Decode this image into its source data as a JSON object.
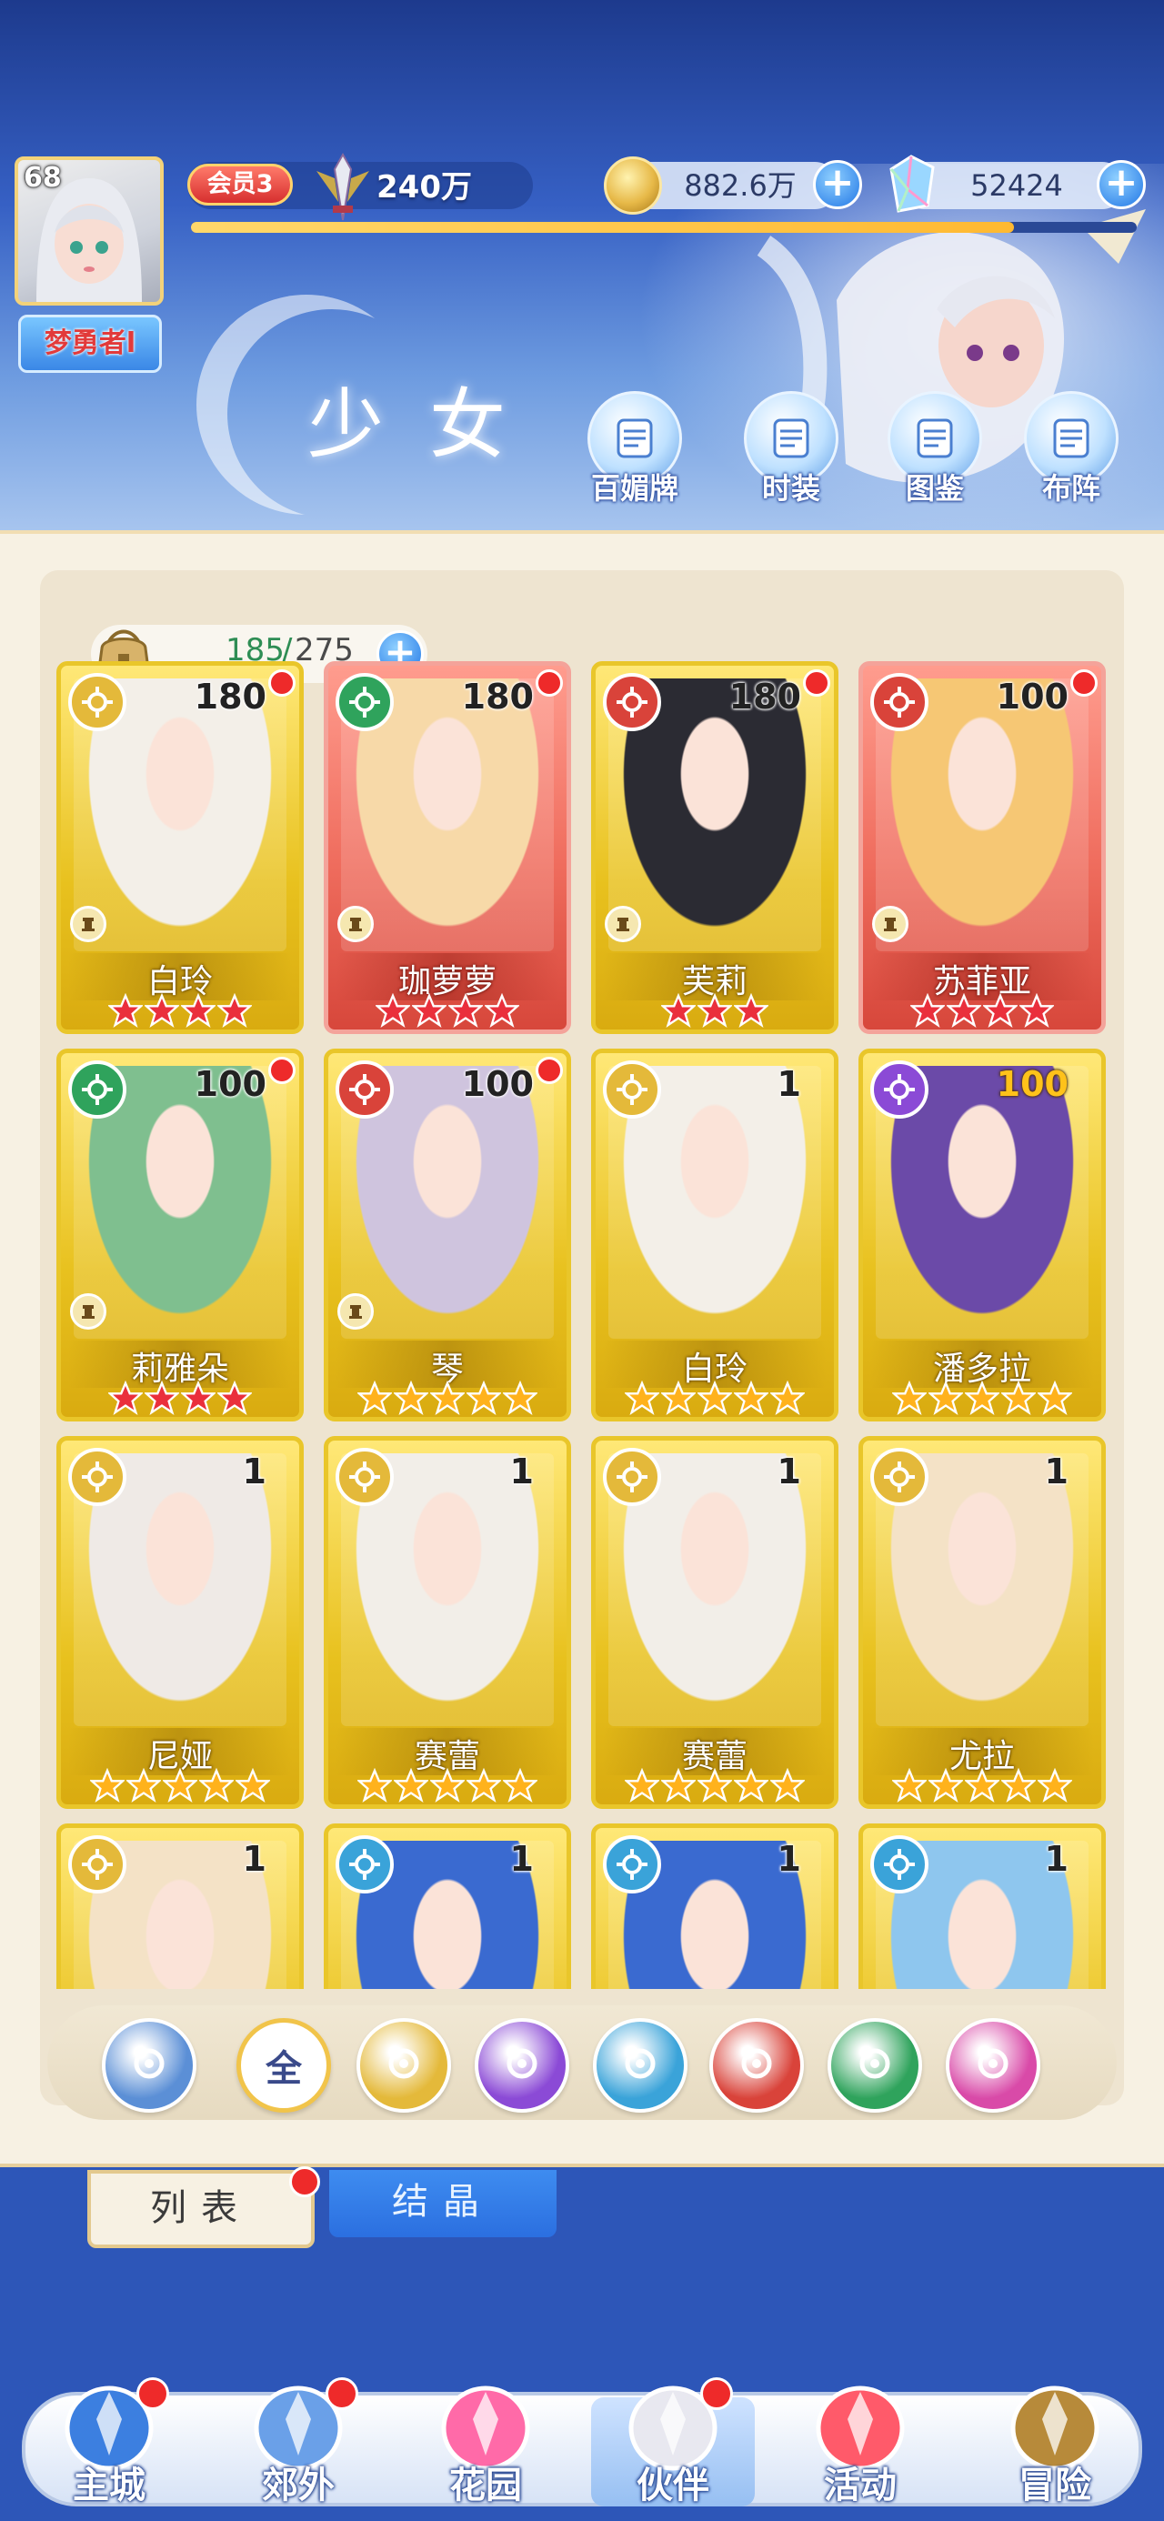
{
  "player": {
    "level": "68",
    "name": "梦勇者l",
    "vip": "会员3",
    "power": "240万",
    "exp_fraction": 0.87
  },
  "resources": {
    "gold": "882.6万",
    "gems": "52424"
  },
  "page_title": "少女",
  "top_buttons": [
    {
      "label": "百媚牌",
      "icon": "card-deck-icon"
    },
    {
      "label": "时装",
      "icon": "outfit-icon"
    },
    {
      "label": "图鉴",
      "icon": "codex-book-icon"
    },
    {
      "label": "布阵",
      "icon": "formation-grid-icon"
    }
  ],
  "capacity": {
    "current": "185",
    "separator": "/",
    "max": "275"
  },
  "elements": {
    "light": {
      "color": "#e4b93a",
      "glyph": "☀"
    },
    "wind": {
      "color": "#2fa35c",
      "glyph": "≋"
    },
    "fire": {
      "color": "#d9433a",
      "glyph": "♨"
    },
    "water": {
      "color": "#3aa3d9",
      "glyph": "💧"
    },
    "dark": {
      "color": "#8b4ad6",
      "glyph": "☾"
    }
  },
  "cards": [
    {
      "name": "白玲",
      "level": "180",
      "element": "light",
      "stars": 4,
      "star_color": "red",
      "bg": "gold",
      "dot": true,
      "role": true
    },
    {
      "name": "珈萝萝",
      "level": "180",
      "element": "wind",
      "stars": 4,
      "star_color": "red",
      "bg": "red",
      "dot": true,
      "role": true
    },
    {
      "name": "芙莉",
      "level": "180",
      "element": "fire",
      "stars": 3,
      "star_color": "red",
      "bg": "gold",
      "dot": true,
      "role": true
    },
    {
      "name": "苏菲亚",
      "level": "100",
      "element": "fire",
      "stars": 4,
      "star_color": "red",
      "bg": "red",
      "dot": true,
      "role": true
    },
    {
      "name": "莉雅朵",
      "level": "100",
      "element": "wind",
      "stars": 4,
      "star_color": "red",
      "bg": "gold",
      "dot": true,
      "role": true
    },
    {
      "name": "琴",
      "level": "100",
      "element": "fire",
      "stars": 5,
      "star_color": "gold",
      "bg": "gold",
      "dot": true,
      "role": true
    },
    {
      "name": "白玲",
      "level": "1",
      "element": "light",
      "stars": 5,
      "star_color": "gold",
      "bg": "gold",
      "dot": false,
      "role": false
    },
    {
      "name": "潘多拉",
      "level": "100",
      "element": "dark",
      "stars": 5,
      "star_color": "gold",
      "bg": "gold",
      "dot": false,
      "role": false,
      "level_gold": true
    },
    {
      "name": "尼娅",
      "level": "1",
      "element": "light",
      "stars": 5,
      "star_color": "gold",
      "bg": "gold",
      "dot": false,
      "role": false
    },
    {
      "name": "赛蕾",
      "level": "1",
      "element": "light",
      "stars": 5,
      "star_color": "gold",
      "bg": "gold",
      "dot": false,
      "role": false
    },
    {
      "name": "赛蕾",
      "level": "1",
      "element": "light",
      "stars": 5,
      "star_color": "gold",
      "bg": "gold",
      "dot": false,
      "role": false
    },
    {
      "name": "尤拉",
      "level": "1",
      "element": "light",
      "stars": 5,
      "star_color": "gold",
      "bg": "gold",
      "dot": false,
      "role": false
    },
    {
      "name": "",
      "level": "1",
      "element": "light",
      "stars": 0,
      "star_color": "gold",
      "bg": "gold",
      "dot": false,
      "role": false
    },
    {
      "name": "",
      "level": "1",
      "element": "water",
      "stars": 0,
      "star_color": "gold",
      "bg": "gold",
      "dot": false,
      "role": false
    },
    {
      "name": "",
      "level": "1",
      "element": "water",
      "stars": 0,
      "star_color": "gold",
      "bg": "gold",
      "dot": false,
      "role": false
    },
    {
      "name": "",
      "level": "1",
      "element": "water",
      "stars": 0,
      "star_color": "gold",
      "bg": "gold",
      "dot": false,
      "role": false
    }
  ],
  "filters": [
    {
      "id": "sort",
      "icon": "sort-arrow-icon",
      "label": "",
      "color": "#5b8fd6"
    },
    {
      "id": "all",
      "icon": "all-filter-icon",
      "label": "全",
      "color": "#ffffff"
    },
    {
      "id": "light",
      "icon": "sun-icon",
      "label": "",
      "color": "#e4b93a"
    },
    {
      "id": "dark",
      "icon": "moon-icon",
      "label": "",
      "color": "#8b4ad6"
    },
    {
      "id": "water",
      "icon": "water-drop-icon",
      "label": "",
      "color": "#3aa3d9"
    },
    {
      "id": "fire",
      "icon": "flame-icon",
      "label": "",
      "color": "#d9433a"
    },
    {
      "id": "wind",
      "icon": "whirlwind-icon",
      "label": "",
      "color": "#2fa35c"
    },
    {
      "id": "charm",
      "icon": "charm-orb-icon",
      "label": "",
      "color": "#d94aa8"
    }
  ],
  "tabs": {
    "list": "列表",
    "crystal": "结晶"
  },
  "bottom_nav": [
    {
      "label": "主城",
      "icon": "castle-icon",
      "dot": true
    },
    {
      "label": "郊外",
      "icon": "hexagram-gate-icon",
      "dot": true
    },
    {
      "label": "花园",
      "icon": "heart-garden-icon",
      "dot": false
    },
    {
      "label": "伙伴",
      "icon": "partner-avatar-icon",
      "dot": true,
      "active": true
    },
    {
      "label": "活动",
      "icon": "gift-box-icon",
      "dot": false
    },
    {
      "label": "冒险",
      "icon": "compass-icon",
      "dot": false
    }
  ]
}
